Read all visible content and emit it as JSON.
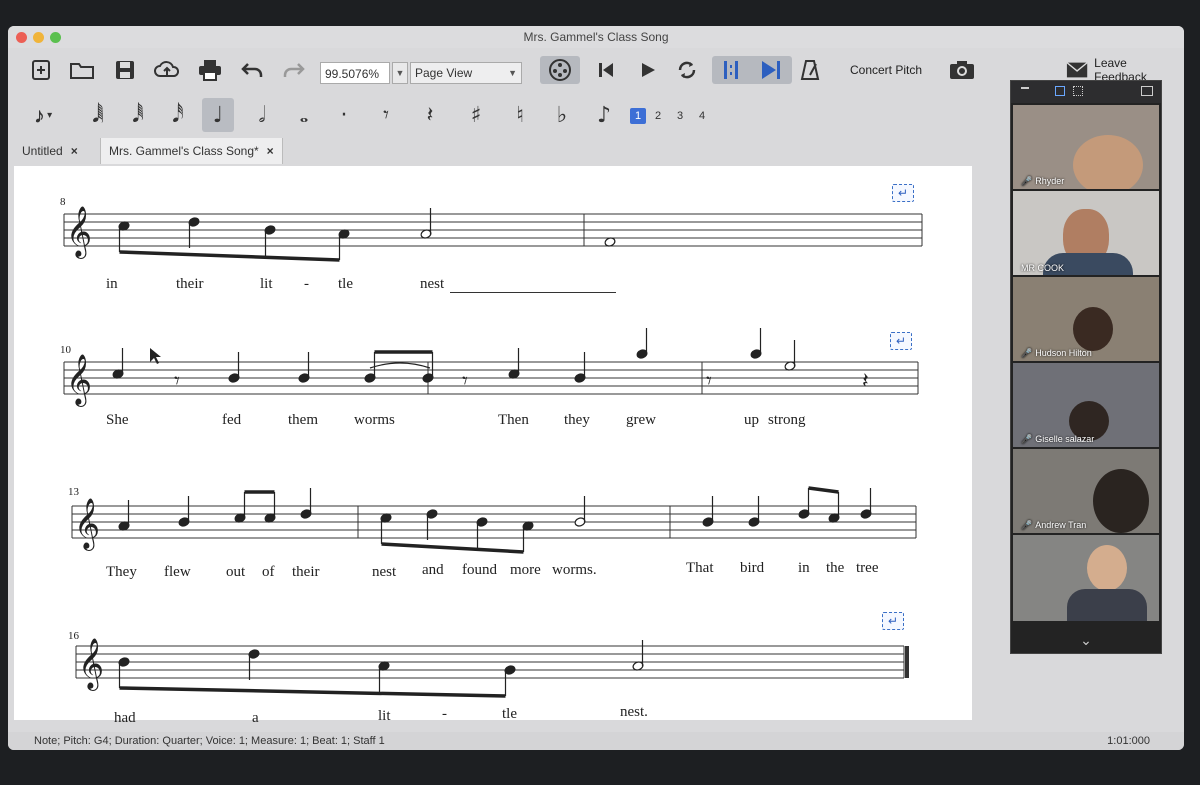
{
  "window": {
    "title": "Mrs. Gammel's Class Song",
    "traffic_lights": [
      "#ec5f55",
      "#f0b43a",
      "#5bc04f"
    ]
  },
  "toolbar": {
    "zoom_value": "99.5076%",
    "view_mode": "Page View",
    "concert_pitch_label": "Concert Pitch",
    "leave_feedback_label": "Leave Feedback",
    "icons": [
      "new-score-icon",
      "open-folder-icon",
      "save-icon",
      "cloud-upload-icon",
      "print-icon",
      "undo-icon",
      "redo-icon",
      "mixer-icon",
      "rewind-icon",
      "play-icon",
      "loop-icon",
      "play-selection-icon",
      "play-to-end-icon",
      "metronome-icon",
      "camera-icon",
      "mail-icon"
    ]
  },
  "note_palette": {
    "entry_symbol": "𝆕",
    "glyphs": [
      "𝅘𝅥𝅲",
      "𝅘𝅥𝅱",
      "𝅘𝅥𝅰",
      "𝅘𝅥𝅯",
      "♩",
      "𝅗𝅥",
      "𝅝",
      "·",
      "𝄾",
      "𝄽",
      "♯",
      "♮",
      "♭",
      "♪"
    ],
    "selected_index": 4,
    "voices": [
      "1",
      "2",
      "3",
      "4"
    ],
    "selected_voice": "1"
  },
  "tabs": [
    {
      "label": "Untitled",
      "close": "×"
    },
    {
      "label": "Mrs. Gammel's Class Song*",
      "close": "×"
    }
  ],
  "score": {
    "systems": [
      {
        "measure_number": "8",
        "lyrics": [
          "in",
          "their",
          "lit",
          "-",
          "tle",
          "nest"
        ]
      },
      {
        "measure_number": "10",
        "lyrics": [
          "She",
          "fed",
          "them",
          "worms",
          "Then",
          "they",
          "grew",
          "up",
          "strong"
        ]
      },
      {
        "measure_number": "13",
        "lyrics": [
          "They",
          "flew",
          "out",
          "of",
          "their",
          "nest",
          "and",
          "found",
          "more",
          "worms.",
          "That",
          "bird",
          "in",
          "the",
          "tree"
        ]
      },
      {
        "measure_number": "16",
        "lyrics": [
          "had",
          "a",
          "lit",
          "-",
          "tle",
          "nest."
        ]
      }
    ],
    "return_button_glyph": "↵"
  },
  "status": {
    "text": "Note; Pitch: G4; Duration: Quarter; Voice: 1;  Measure: 1; Beat: 1; Staff 1",
    "timecode": "1:01:000"
  },
  "video_call": {
    "participants": [
      {
        "name": "Rhyder",
        "bg": "#9a8f86"
      },
      {
        "name": "MR COOK",
        "bg": "#c9c7c4"
      },
      {
        "name": "Hudson Hilton",
        "bg": "#8a8073"
      },
      {
        "name": "Giselle salazar",
        "bg": "#6f7077"
      },
      {
        "name": "Andrew Tran",
        "bg": "#7d7a75"
      },
      {
        "name": "",
        "bg": "#858583"
      }
    ],
    "chevron": "⌄"
  }
}
